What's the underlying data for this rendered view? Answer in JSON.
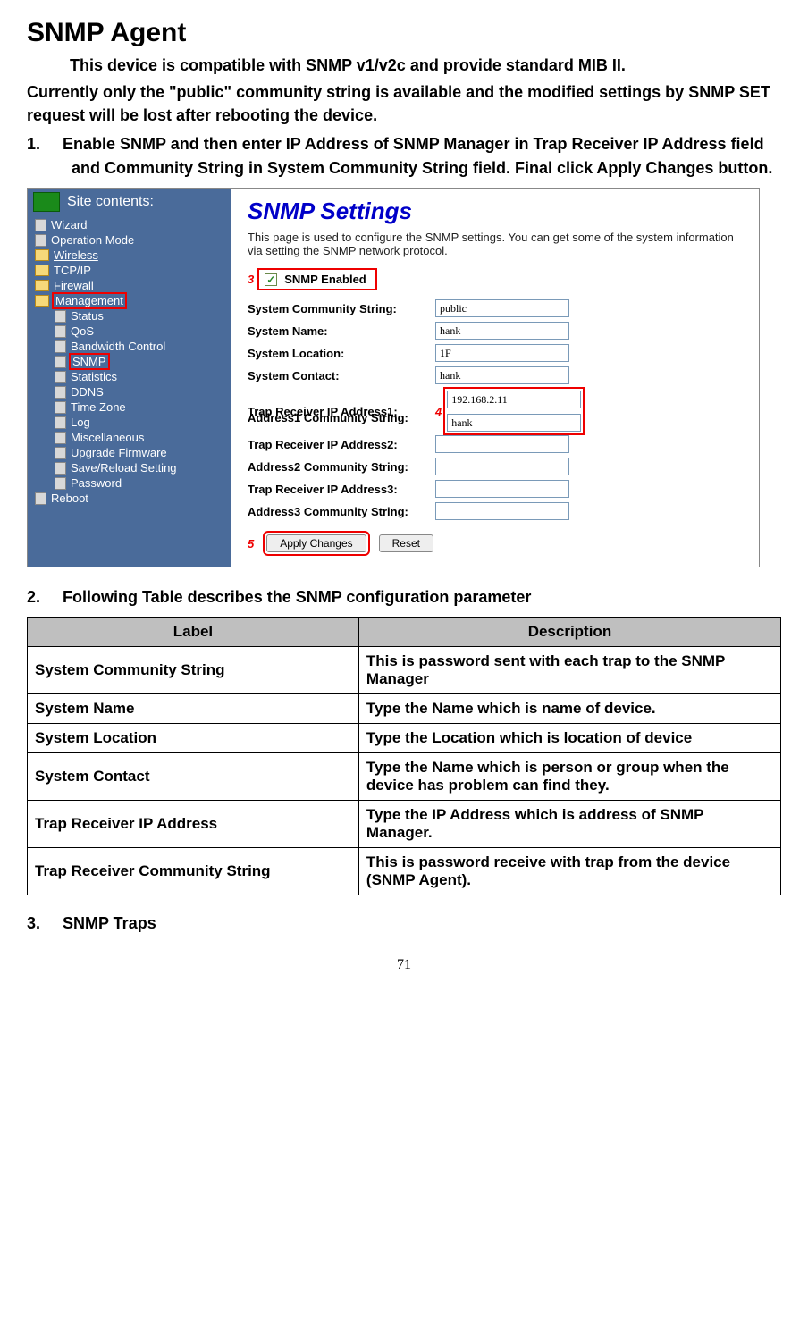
{
  "title": "SNMP Agent",
  "intro_p1": "This device is compatible with SNMP v1/v2c and provide standard MIB II.",
  "intro_p2": "Currently only the \"public\" community string is available and the modified settings by SNMP SET request will be lost after rebooting the device.",
  "step1_num": "1.",
  "step1": "Enable SNMP and then enter IP Address of SNMP Manager in Trap Receiver IP Address field and Community String in System Community String field. Final click Apply Changes button.",
  "step2_num": "2.",
  "step2": "Following Table describes the SNMP configuration parameter",
  "step3_num": "3.",
  "step3": "SNMP Traps",
  "sidebar": {
    "header": "Site contents:",
    "items": [
      "Wizard",
      "Operation Mode",
      "Wireless",
      "TCP/IP",
      "Firewall",
      "Management"
    ],
    "sub": [
      "Status",
      "QoS",
      "Bandwidth Control",
      "SNMP",
      "Statistics",
      "DDNS",
      "Time Zone",
      "Log",
      "Miscellaneous",
      "Upgrade Firmware",
      "Save/Reload Setting",
      "Password"
    ],
    "reboot": "Reboot"
  },
  "snmp": {
    "heading": "SNMP Settings",
    "desc": "This page is used to configure the SNMP settings. You can get some of the system information via setting the SNMP network protocol.",
    "marker3": "3",
    "marker4": "4",
    "marker5": "5",
    "enabled_label": "SNMP Enabled",
    "rows": [
      {
        "label": "System Community String:",
        "value": "public"
      },
      {
        "label": "System Name:",
        "value": "hank"
      },
      {
        "label": "System Location:",
        "value": "1F"
      },
      {
        "label": "System Contact:",
        "value": "hank"
      },
      {
        "label": "Trap Receiver IP Address1:",
        "value": "192.168.2.11"
      },
      {
        "label": "Address1 Community String:",
        "value": "hank"
      },
      {
        "label": "Trap Receiver IP Address2:",
        "value": ""
      },
      {
        "label": "Address2 Community String:",
        "value": ""
      },
      {
        "label": "Trap Receiver IP Address3:",
        "value": ""
      },
      {
        "label": "Address3 Community String:",
        "value": ""
      }
    ],
    "apply": "Apply Changes",
    "reset": "Reset"
  },
  "table": {
    "h1": "Label",
    "h2": "Description",
    "rows": [
      {
        "l": "System Community String",
        "d": "This is password sent with each trap to the SNMP Manager"
      },
      {
        "l": "System Name",
        "d": "Type the Name which is name of device."
      },
      {
        "l": "System Location",
        "d": "Type the Location which is location of device"
      },
      {
        "l": "System Contact",
        "d": "Type the Name which is person or group when the device has problem can find they."
      },
      {
        "l": "Trap Receiver IP Address",
        "d": "Type the IP Address which is address of SNMP Manager."
      },
      {
        "l": "Trap Receiver Community String",
        "d": "This is password receive with trap from the device (SNMP Agent)."
      }
    ]
  },
  "page_num": "71"
}
